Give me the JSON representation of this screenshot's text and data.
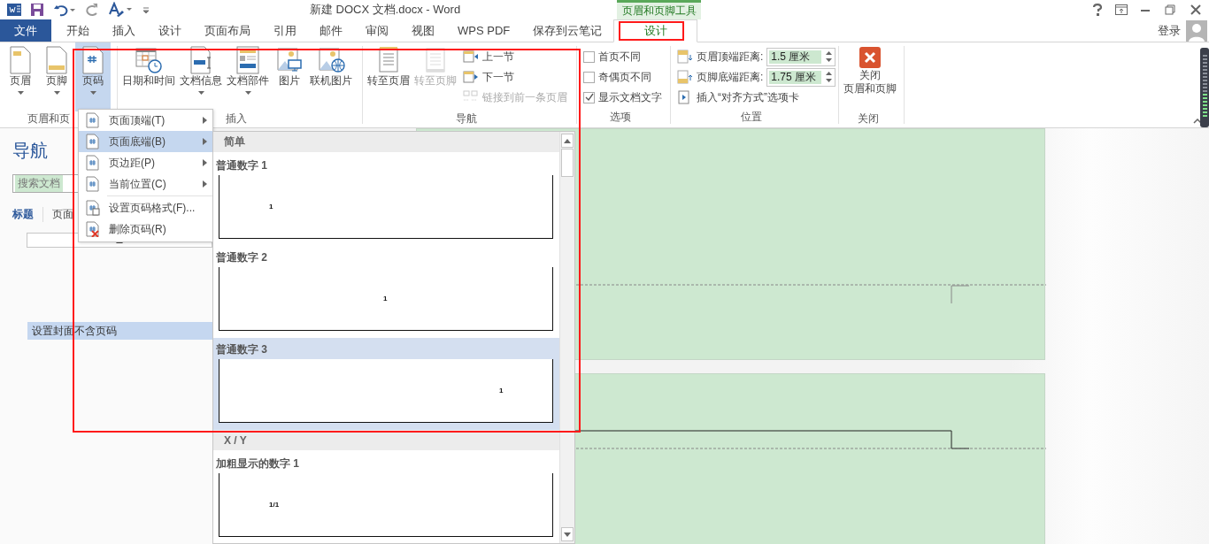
{
  "title_bar": {
    "title": "新建 DOCX 文档.docx - Word",
    "context_group": "页眉和页脚工具"
  },
  "tabs": [
    {
      "label": "文件",
      "kind": "file",
      "selected": false
    },
    {
      "label": "开始",
      "kind": "tab",
      "selected": false
    },
    {
      "label": "插入",
      "kind": "tab",
      "selected": false
    },
    {
      "label": "设计",
      "kind": "tab",
      "selected": false
    },
    {
      "label": "页面布局",
      "kind": "tab",
      "selected": false
    },
    {
      "label": "引用",
      "kind": "tab",
      "selected": false
    },
    {
      "label": "邮件",
      "kind": "tab",
      "selected": false
    },
    {
      "label": "审阅",
      "kind": "tab",
      "selected": false
    },
    {
      "label": "视图",
      "kind": "tab",
      "selected": false
    },
    {
      "label": "WPS PDF",
      "kind": "tab",
      "selected": false
    },
    {
      "label": "保存到云笔记",
      "kind": "tab",
      "selected": false
    },
    {
      "label": "设计",
      "kind": "context",
      "selected": true
    }
  ],
  "account": {
    "label": "登录"
  },
  "ribbon_groups": [
    {
      "label": "页眉和页",
      "items": [
        {
          "kind": "large",
          "label": "页眉",
          "dropdown": true,
          "pressed": false,
          "disabled": false
        },
        {
          "kind": "large",
          "label": "页脚",
          "dropdown": true,
          "pressed": false,
          "disabled": false
        },
        {
          "kind": "large",
          "label": "页码",
          "dropdown": true,
          "pressed": true,
          "disabled": false
        }
      ]
    },
    {
      "label": "插入",
      "items": [
        {
          "kind": "large",
          "label": "日期和时间",
          "dropdown": false,
          "pressed": false,
          "disabled": false
        },
        {
          "kind": "large",
          "label": "文档信息",
          "dropdown": true,
          "pressed": false,
          "disabled": false
        },
        {
          "kind": "large",
          "label": "文档部件",
          "dropdown": true,
          "pressed": false,
          "disabled": false
        },
        {
          "kind": "large",
          "label": "图片",
          "dropdown": false,
          "pressed": false,
          "disabled": false
        },
        {
          "kind": "large",
          "label": "联机图片",
          "dropdown": false,
          "pressed": false,
          "disabled": false
        }
      ]
    },
    {
      "label": "导航",
      "items": [
        {
          "kind": "large",
          "label": "转至页眉",
          "dropdown": false,
          "pressed": false,
          "disabled": false
        },
        {
          "kind": "large",
          "label": "转至页脚",
          "dropdown": false,
          "pressed": false,
          "disabled": true
        },
        {
          "kind": "small",
          "label": "上一节",
          "disabled": false
        },
        {
          "kind": "small",
          "label": "下一节",
          "disabled": false
        },
        {
          "kind": "small",
          "label": "链接到前一条页眉",
          "disabled": true
        }
      ]
    },
    {
      "label": "选项",
      "items": [
        {
          "kind": "checkbox",
          "label": "首页不同",
          "checked": false
        },
        {
          "kind": "checkbox",
          "label": "奇偶页不同",
          "checked": false
        },
        {
          "kind": "checkbox",
          "label": "显示文档文字",
          "checked": true
        }
      ]
    },
    {
      "label": "位置",
      "items": [
        {
          "kind": "spinner",
          "label": "页眉顶端距离:",
          "value": "1.5 厘米"
        },
        {
          "kind": "spinner",
          "label": "页脚底端距离:",
          "value": "1.75 厘米"
        },
        {
          "kind": "small",
          "label": "插入“对齐方式”选项卡",
          "disabled": false
        }
      ]
    },
    {
      "label": "关闭",
      "items": [
        {
          "kind": "large",
          "label": "关闭",
          "label_2": "页眉和页脚",
          "dropdown": false,
          "pressed": false,
          "disabled": false
        }
      ]
    }
  ],
  "navigation": {
    "title": "导航",
    "search": {
      "placeholder": "搜索文档"
    },
    "tabs": [
      {
        "label": "标题",
        "selected": true
      },
      {
        "label": "页面",
        "selected": false
      }
    ],
    "headings": [
      {
        "label": "设置封面不含页码",
        "selected": true
      }
    ]
  },
  "page_number_menu": [
    {
      "label": "页面顶端(T)",
      "submenu": true,
      "selected": false
    },
    {
      "label": "页面底端(B)",
      "submenu": true,
      "selected": true
    },
    {
      "label": "页边距(P)",
      "submenu": true,
      "selected": false
    },
    {
      "label": "当前位置(C)",
      "submenu": true,
      "selected": false
    },
    {
      "label": "设置页码格式(F)...",
      "submenu": false,
      "selected": false
    },
    {
      "label": "删除页码(R)",
      "submenu": false,
      "selected": false
    }
  ],
  "gallery": [
    {
      "kind": "section",
      "label": "简单"
    },
    {
      "kind": "item",
      "label": "普通数字 1",
      "preview": "1",
      "selected": false
    },
    {
      "kind": "item",
      "label": "普通数字 2",
      "preview": "1",
      "selected": false
    },
    {
      "kind": "item",
      "label": "普通数字 3",
      "preview": "1",
      "selected": true
    },
    {
      "kind": "section",
      "label": "X / Y"
    },
    {
      "kind": "item",
      "label": "加粗显示的数字 1",
      "preview": "1/1",
      "selected": false
    }
  ]
}
